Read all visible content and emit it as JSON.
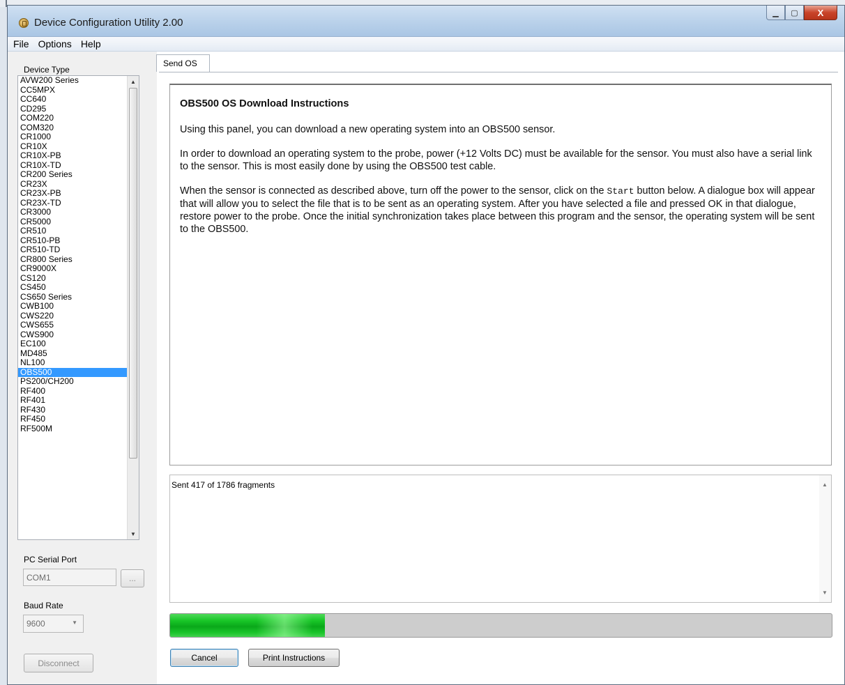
{
  "window": {
    "title": "Device Configuration Utility 2.00",
    "controls": {
      "minimize": "▁",
      "maximize": "▢",
      "close": "X"
    }
  },
  "menu": [
    "File",
    "Options",
    "Help"
  ],
  "sidebar": {
    "device_type_label": "Device Type",
    "devices": [
      "AVW200 Series",
      "CC5MPX",
      "CC640",
      "CD295",
      "COM220",
      "COM320",
      "CR1000",
      "CR10X",
      "CR10X-PB",
      "CR10X-TD",
      "CR200 Series",
      "CR23X",
      "CR23X-PB",
      "CR23X-TD",
      "CR3000",
      "CR5000",
      "CR510",
      "CR510-PB",
      "CR510-TD",
      "CR800 Series",
      "CR9000X",
      "CS120",
      "CS450",
      "CS650 Series",
      "CWB100",
      "CWS220",
      "CWS655",
      "CWS900",
      "EC100",
      "MD485",
      "NL100",
      "OBS500",
      "PS200/CH200",
      "RF400",
      "RF401",
      "RF430",
      "RF450",
      "RF500M"
    ],
    "selected_device": "OBS500",
    "serial_port_label": "PC Serial Port",
    "serial_port_value": "COM1",
    "browse_label": "...",
    "baud_rate_label": "Baud Rate",
    "baud_rate_value": "9600",
    "disconnect_label": "Disconnect"
  },
  "tab": {
    "label": "Send OS"
  },
  "instructions": {
    "heading": "OBS500 OS Download Instructions",
    "p1": "Using this panel, you can download a new operating system into an OBS500 sensor.",
    "p2": "In order to download an operating system to the probe, power (+12 Volts DC) must be available for the sensor. You must also have a serial link to the sensor. This is most easily done by using the OBS500 test cable.",
    "p3_before": "When the sensor is connected as described above, turn off the power to the sensor, click on the ",
    "p3_code": "Start",
    "p3_after": " button below. A dialogue box will appear that will allow you to select the file that is to be sent as an operating system. After you have selected a file and pressed OK in that dialogue, restore power to the probe. Once the initial synchronization takes place between this program and the sensor, the operating system will be sent to the OBS500."
  },
  "log": {
    "text": "Sent 417 of 1786 fragments"
  },
  "progress": {
    "fraction": 0.2335
  },
  "buttons": {
    "cancel": "Cancel",
    "print": "Print Instructions"
  },
  "colors": {
    "selection": "#3399ff",
    "progress_fill": "#18c527"
  }
}
